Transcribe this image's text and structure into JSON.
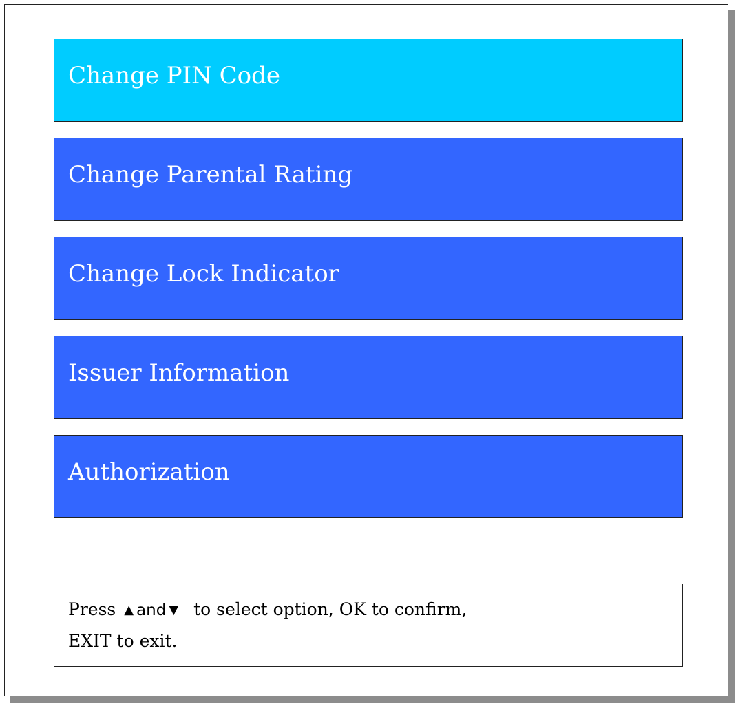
{
  "menu": {
    "items": [
      {
        "label": "Change PIN Code",
        "selected": true
      },
      {
        "label": "Change Parental Rating",
        "selected": false
      },
      {
        "label": "Change Lock Indicator",
        "selected": false
      },
      {
        "label": "Issuer Information",
        "selected": false
      },
      {
        "label": "Authorization",
        "selected": false
      }
    ]
  },
  "hint": {
    "press": "Press",
    "and": "and",
    "rest_line1": "to select option, OK to confirm,",
    "line2": "EXIT to exit.",
    "up_icon": "up-arrow-icon",
    "down_icon": "down-arrow-icon"
  },
  "colors": {
    "selected": "#00ccff",
    "item": "#3366ff",
    "text_on_item": "#ffffff",
    "shadow": "#8c8c8c"
  }
}
